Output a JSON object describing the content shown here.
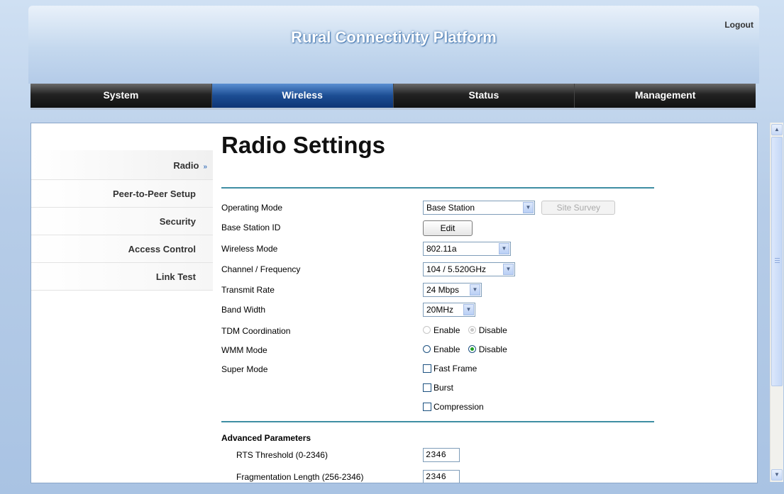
{
  "header": {
    "title": "Rural Connectivity Platform",
    "logout": "Logout"
  },
  "nav": [
    {
      "label": "System",
      "active": false
    },
    {
      "label": "Wireless",
      "active": true
    },
    {
      "label": "Status",
      "active": false
    },
    {
      "label": "Management",
      "active": false
    }
  ],
  "sidebar": {
    "items": [
      {
        "label": "Radio",
        "active": true
      },
      {
        "label": "Peer-to-Peer Setup",
        "active": false
      },
      {
        "label": "Security",
        "active": false
      },
      {
        "label": "Access Control",
        "active": false
      },
      {
        "label": "Link Test",
        "active": false
      }
    ],
    "active_marker": "»"
  },
  "page": {
    "title": "Radio Settings"
  },
  "form": {
    "operating_mode": {
      "label": "Operating Mode",
      "value": "Base Station",
      "site_survey": "Site Survey"
    },
    "base_station_id": {
      "label": "Base Station ID",
      "button": "Edit"
    },
    "wireless_mode": {
      "label": "Wireless Mode",
      "value": "802.11a"
    },
    "channel": {
      "label": "Channel / Frequency",
      "value": "104 / 5.520GHz"
    },
    "transmit_rate": {
      "label": "Transmit Rate",
      "value": "24 Mbps"
    },
    "band_width": {
      "label": "Band Width",
      "value": "20MHz"
    },
    "tdm": {
      "label": "TDM Coordination",
      "enable": "Enable",
      "disable": "Disable",
      "selected": "Disable",
      "disabled": true
    },
    "wmm": {
      "label": "WMM Mode",
      "enable": "Enable",
      "disable": "Disable",
      "selected": "Disable"
    },
    "super_mode": {
      "label": "Super Mode",
      "fast_frame": "Fast Frame",
      "burst": "Burst",
      "compression": "Compression"
    }
  },
  "advanced": {
    "title": "Advanced Parameters",
    "rts": {
      "label": "RTS Threshold (0-2346)",
      "value": "2346"
    },
    "frag": {
      "label": "Fragmentation Length (256-2346)",
      "value": "2346"
    }
  }
}
